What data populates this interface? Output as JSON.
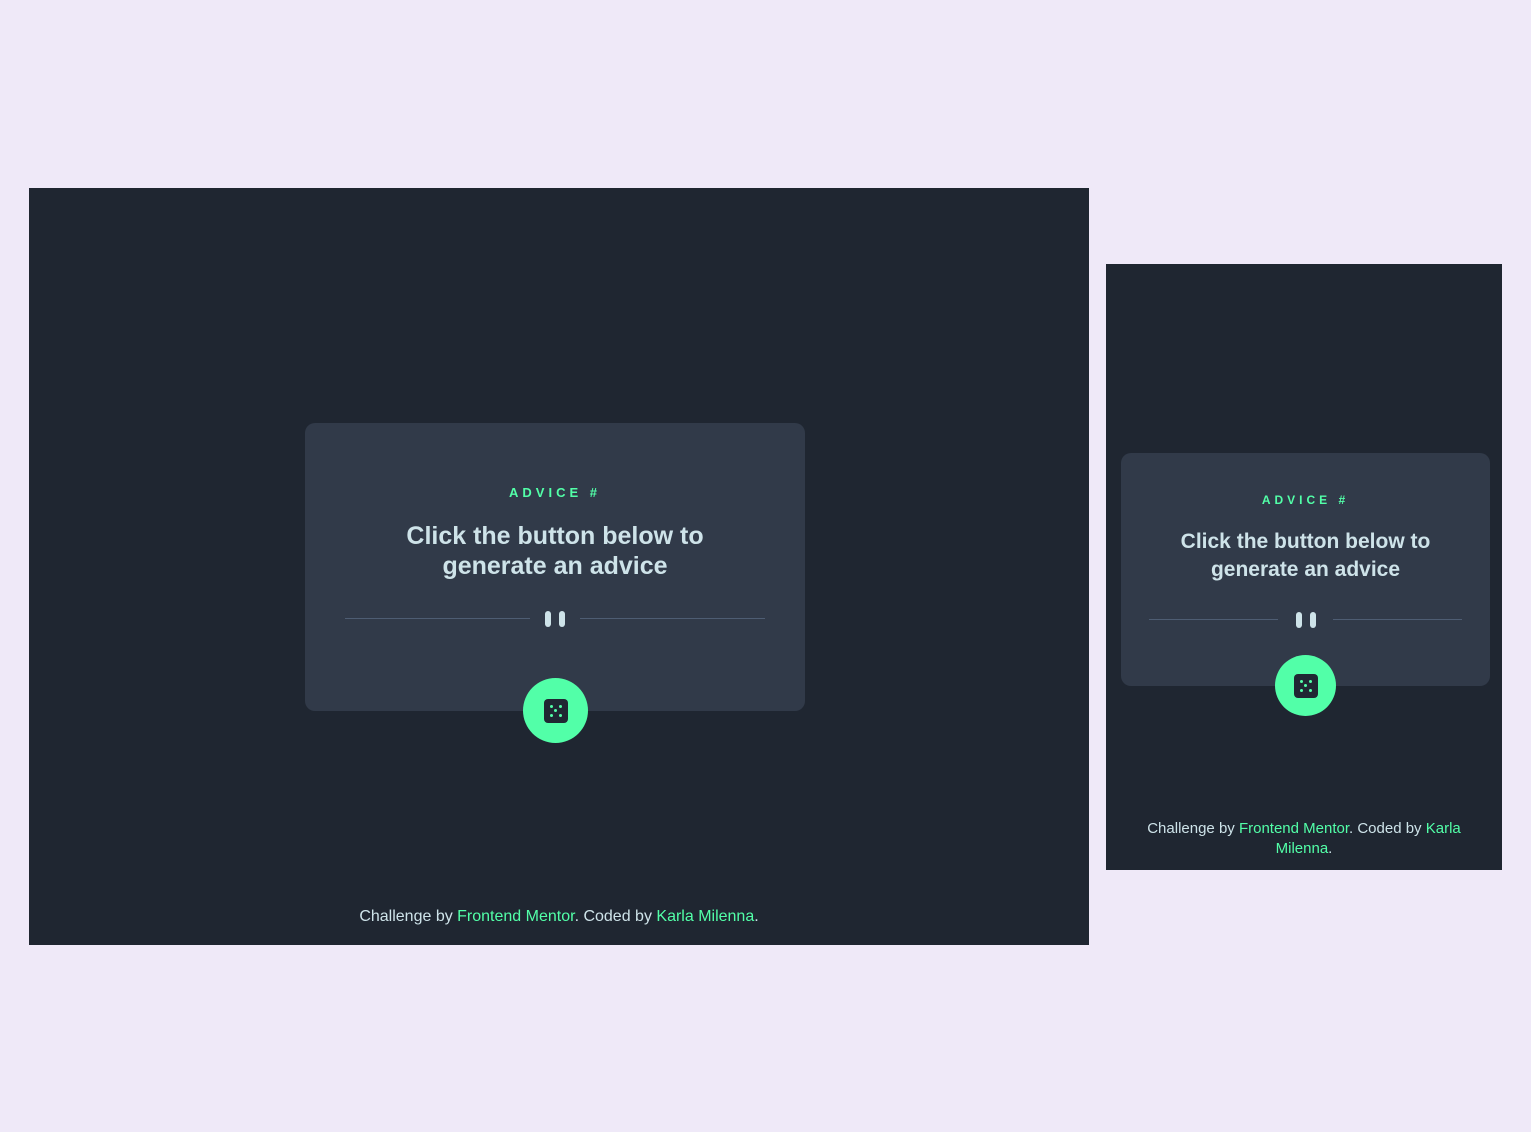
{
  "card": {
    "label": "ADVICE #",
    "text": "Click the button below to generate an advice"
  },
  "footer": {
    "prefix": "Challenge by ",
    "challenge_link": "Frontend Mentor",
    "middle": ". Coded by ",
    "author_link": "Karla Milenna",
    "suffix": "."
  },
  "icons": {
    "divider": "pause-icon",
    "button": "dice-icon"
  },
  "colors": {
    "page_background": "#efe9f8",
    "app_background": "#1f2631",
    "card_background": "#313a49",
    "accent": "#52ffa8",
    "text": "#cee3e9"
  }
}
